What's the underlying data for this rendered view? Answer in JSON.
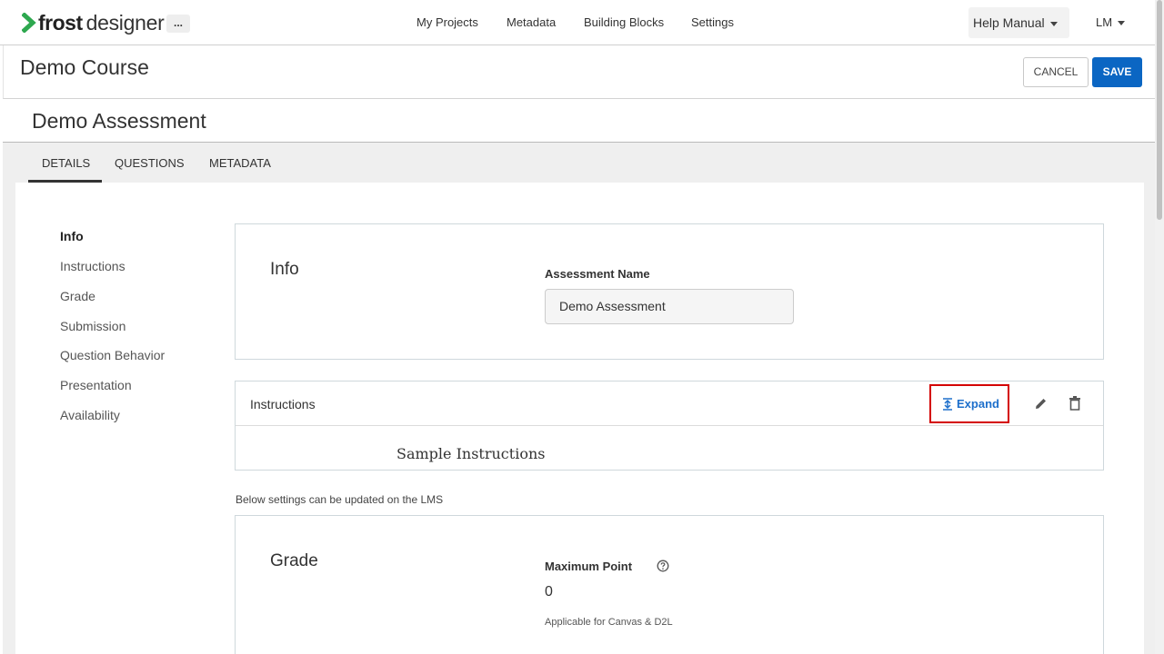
{
  "topnav": {
    "logo_bold": "frost",
    "logo_regular": "designer",
    "more_label": "...",
    "links": [
      "My Projects",
      "Metadata",
      "Building Blocks",
      "Settings"
    ],
    "help_label": "Help Manual",
    "user_label": "LM"
  },
  "course": {
    "title": "Demo Course",
    "cancel_label": "CANCEL",
    "save_label": "SAVE"
  },
  "assessment": {
    "title": "Demo Assessment",
    "tabs": [
      "DETAILS",
      "QUESTIONS",
      "METADATA"
    ],
    "active_tab": "DETAILS"
  },
  "sidebar": {
    "items": [
      "Info",
      "Instructions",
      "Grade",
      "Submission",
      "Question Behavior",
      "Presentation",
      "Availability"
    ],
    "active_item": "Info"
  },
  "info_panel": {
    "heading": "Info",
    "name_label": "Assessment Name",
    "name_value": "Demo Assessment"
  },
  "instructions_panel": {
    "title": "Instructions",
    "expand_label": "Expand",
    "body": "Sample Instructions"
  },
  "lms_note": "Below settings can be updated on the LMS",
  "grade_panel": {
    "heading": "Grade",
    "max_label": "Maximum Point",
    "max_value": "0",
    "applicable": "Applicable for Canvas & D2L"
  },
  "colors": {
    "primary": "#0b66c3",
    "logo_green": "#2ea84f",
    "highlight_red": "#d40000",
    "link_blue": "#1d6fcb"
  },
  "icons": {
    "logo": "frost-chevron-logo",
    "expand": "expand-vertical-icon",
    "edit": "pencil-icon",
    "delete": "trash-icon",
    "help": "question-circle-icon",
    "caret": "caret-down-icon"
  }
}
